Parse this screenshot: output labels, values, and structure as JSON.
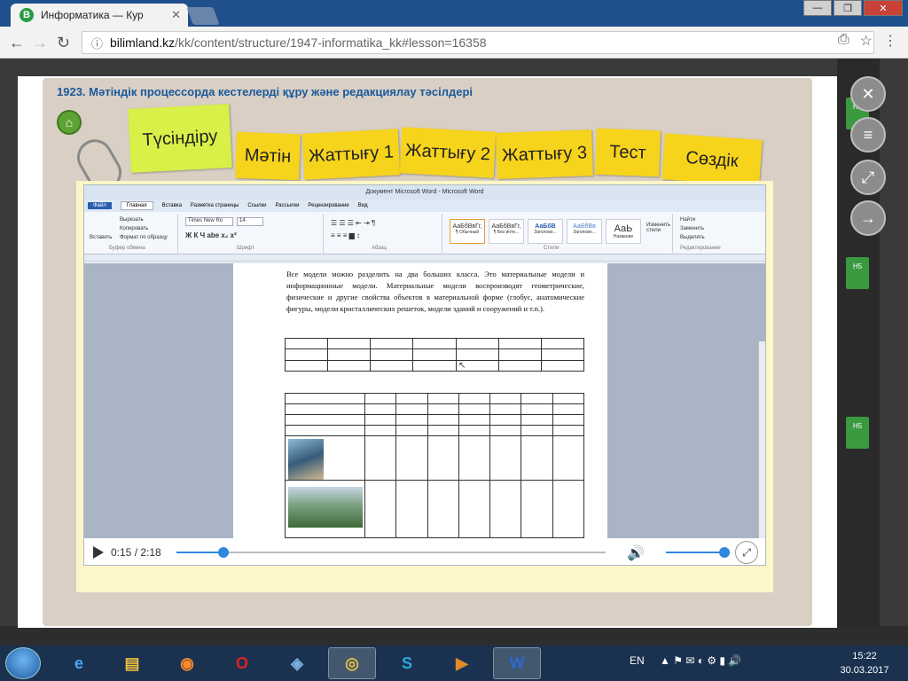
{
  "browser": {
    "tab_title": "Информатика — Кур",
    "favicon_letter": "B",
    "url_host": "bilimland.kz",
    "url_path": "/kk/content/structure/1947-informatika_kk#lesson=16358",
    "window_controls": [
      "—",
      "❐",
      "✕"
    ]
  },
  "lesson": {
    "title": "1923. Мәтіндік процессорда кестелерді құру және редакциялау тәсілдері",
    "tabs": [
      "Түсіндіру",
      "Мәтін",
      "Жаттығу 1",
      "Жаттығу 2",
      "Жаттығу 3",
      "Тест",
      "Сөздік"
    ],
    "active_tab_index": 0
  },
  "word_window": {
    "title": "Документ Microsoft Word - Microsoft Word",
    "menu_tabs": [
      "Файл",
      "Главная",
      "Вставка",
      "Разметка страницы",
      "Ссылки",
      "Рассылки",
      "Рецензирование",
      "Вид"
    ],
    "ribbon": {
      "paste_label": "Вставить",
      "cut_label": "Вырезать",
      "copy_label": "Копировать",
      "format_painter_label": "Формат по образцу",
      "clipboard_group": "Буфер обмена",
      "font_name": "Times New Ro",
      "font_size": "14",
      "font_group": "Шрифт",
      "paragraph_group": "Абзац",
      "styles_group": "Стили",
      "editing_group": "Редактирование",
      "styles": [
        {
          "preview": "АаБбВвГг,",
          "name": "¶ Обычный"
        },
        {
          "preview": "АаБбВвГг,",
          "name": "¶ Без инте..."
        },
        {
          "preview": "АаБбВ",
          "name": "Заголово..."
        },
        {
          "preview": "АаБбВв",
          "name": "Заголово..."
        },
        {
          "preview": "АаЬ",
          "name": "Название"
        }
      ],
      "change_styles": "Изменить стили",
      "find": "Найти",
      "replace": "Заменить",
      "select": "Выделить"
    },
    "doc_text": "Все модели можно разделить на два больших класса. Это материальные модели и информационные модели. Материальные модели воспроизводят геометрические, физические и другие свойства объектов в материальной форме (глобус, анатомические фигуры, модели кристаллических решеток, модели зданий и сооружений и т.п.)."
  },
  "video": {
    "time": "0:15 / 2:18",
    "progress": 0.109,
    "volume": 1.0
  },
  "side_buttons": [
    "close",
    "menu",
    "fullscreen",
    "next"
  ],
  "taskbar": {
    "language": "EN",
    "time": "15:22",
    "date": "30.03.2017",
    "apps": [
      "ie",
      "explorer",
      "firefox",
      "opera",
      "app",
      "chrome",
      "skype",
      "media",
      "word"
    ]
  }
}
